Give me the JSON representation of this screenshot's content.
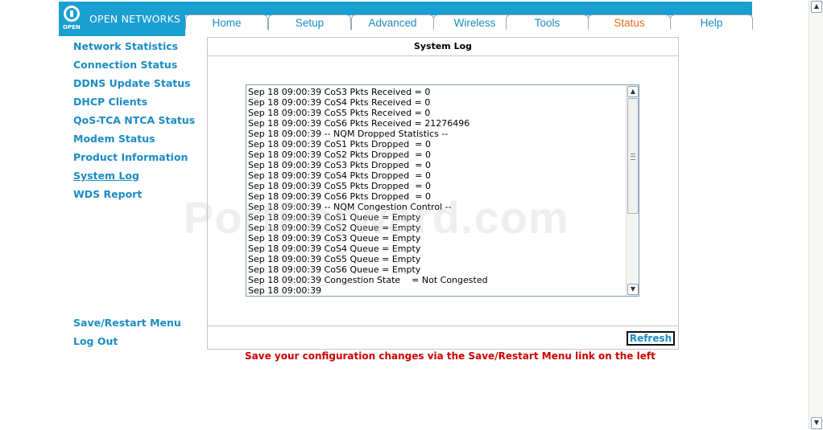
{
  "logo": {
    "brand": "OPEN NETWORKS",
    "mark_text": "OPEN"
  },
  "tabs": [
    {
      "label": "Home",
      "active": false
    },
    {
      "label": "Setup",
      "active": false
    },
    {
      "label": "Advanced",
      "active": false
    },
    {
      "label": "Wireless",
      "active": false
    },
    {
      "label": "Tools",
      "active": false
    },
    {
      "label": "Status",
      "active": true
    },
    {
      "label": "Help",
      "active": false
    }
  ],
  "sidebar": {
    "items": [
      {
        "label": "Network Statistics"
      },
      {
        "label": "Connection Status"
      },
      {
        "label": "DDNS Update Status"
      },
      {
        "label": "DHCP Clients"
      },
      {
        "label": "QoS-TCA NTCA Status"
      },
      {
        "label": "Modem Status"
      },
      {
        "label": "Product Information"
      },
      {
        "label": "System Log",
        "current": true
      },
      {
        "label": "WDS Report"
      }
    ],
    "bottom_items": [
      {
        "label": "Save/Restart Menu"
      },
      {
        "label": "Log Out"
      }
    ]
  },
  "panel": {
    "title": "System Log",
    "log_lines": [
      "Sep 18 09:00:39 CoS3 Pkts Received = 0",
      "Sep 18 09:00:39 CoS4 Pkts Received = 0",
      "Sep 18 09:00:39 CoS5 Pkts Received = 0",
      "Sep 18 09:00:39 CoS6 Pkts Received = 21276496",
      "Sep 18 09:00:39 -- NQM Dropped Statistics --",
      "Sep 18 09:00:39 CoS1 Pkts Dropped  = 0",
      "Sep 18 09:00:39 CoS2 Pkts Dropped  = 0",
      "Sep 18 09:00:39 CoS3 Pkts Dropped  = 0",
      "Sep 18 09:00:39 CoS4 Pkts Dropped  = 0",
      "Sep 18 09:00:39 CoS5 Pkts Dropped  = 0",
      "Sep 18 09:00:39 CoS6 Pkts Dropped  = 0",
      "Sep 18 09:00:39 -- NQM Congestion Control --",
      "Sep 18 09:00:39 CoS1 Queue = Empty",
      "Sep 18 09:00:39 CoS2 Queue = Empty",
      "Sep 18 09:00:39 CoS3 Queue = Empty",
      "Sep 18 09:00:39 CoS4 Queue = Empty",
      "Sep 18 09:00:39 CoS5 Queue = Empty",
      "Sep 18 09:00:39 CoS6 Queue = Empty",
      "Sep 18 09:00:39 Congestion State    = Not Congested",
      "Sep 18 09:00:39"
    ],
    "refresh_label": "Refresh"
  },
  "watermark": "PortForward.com",
  "save_message": "Save your configuration changes via the Save/Restart Menu link on the left",
  "colors": {
    "brand_blue": "#1a9fd1",
    "link_blue": "#1a8cc4",
    "active_tab": "#ef6a18",
    "warning_red": "#cc0000"
  }
}
